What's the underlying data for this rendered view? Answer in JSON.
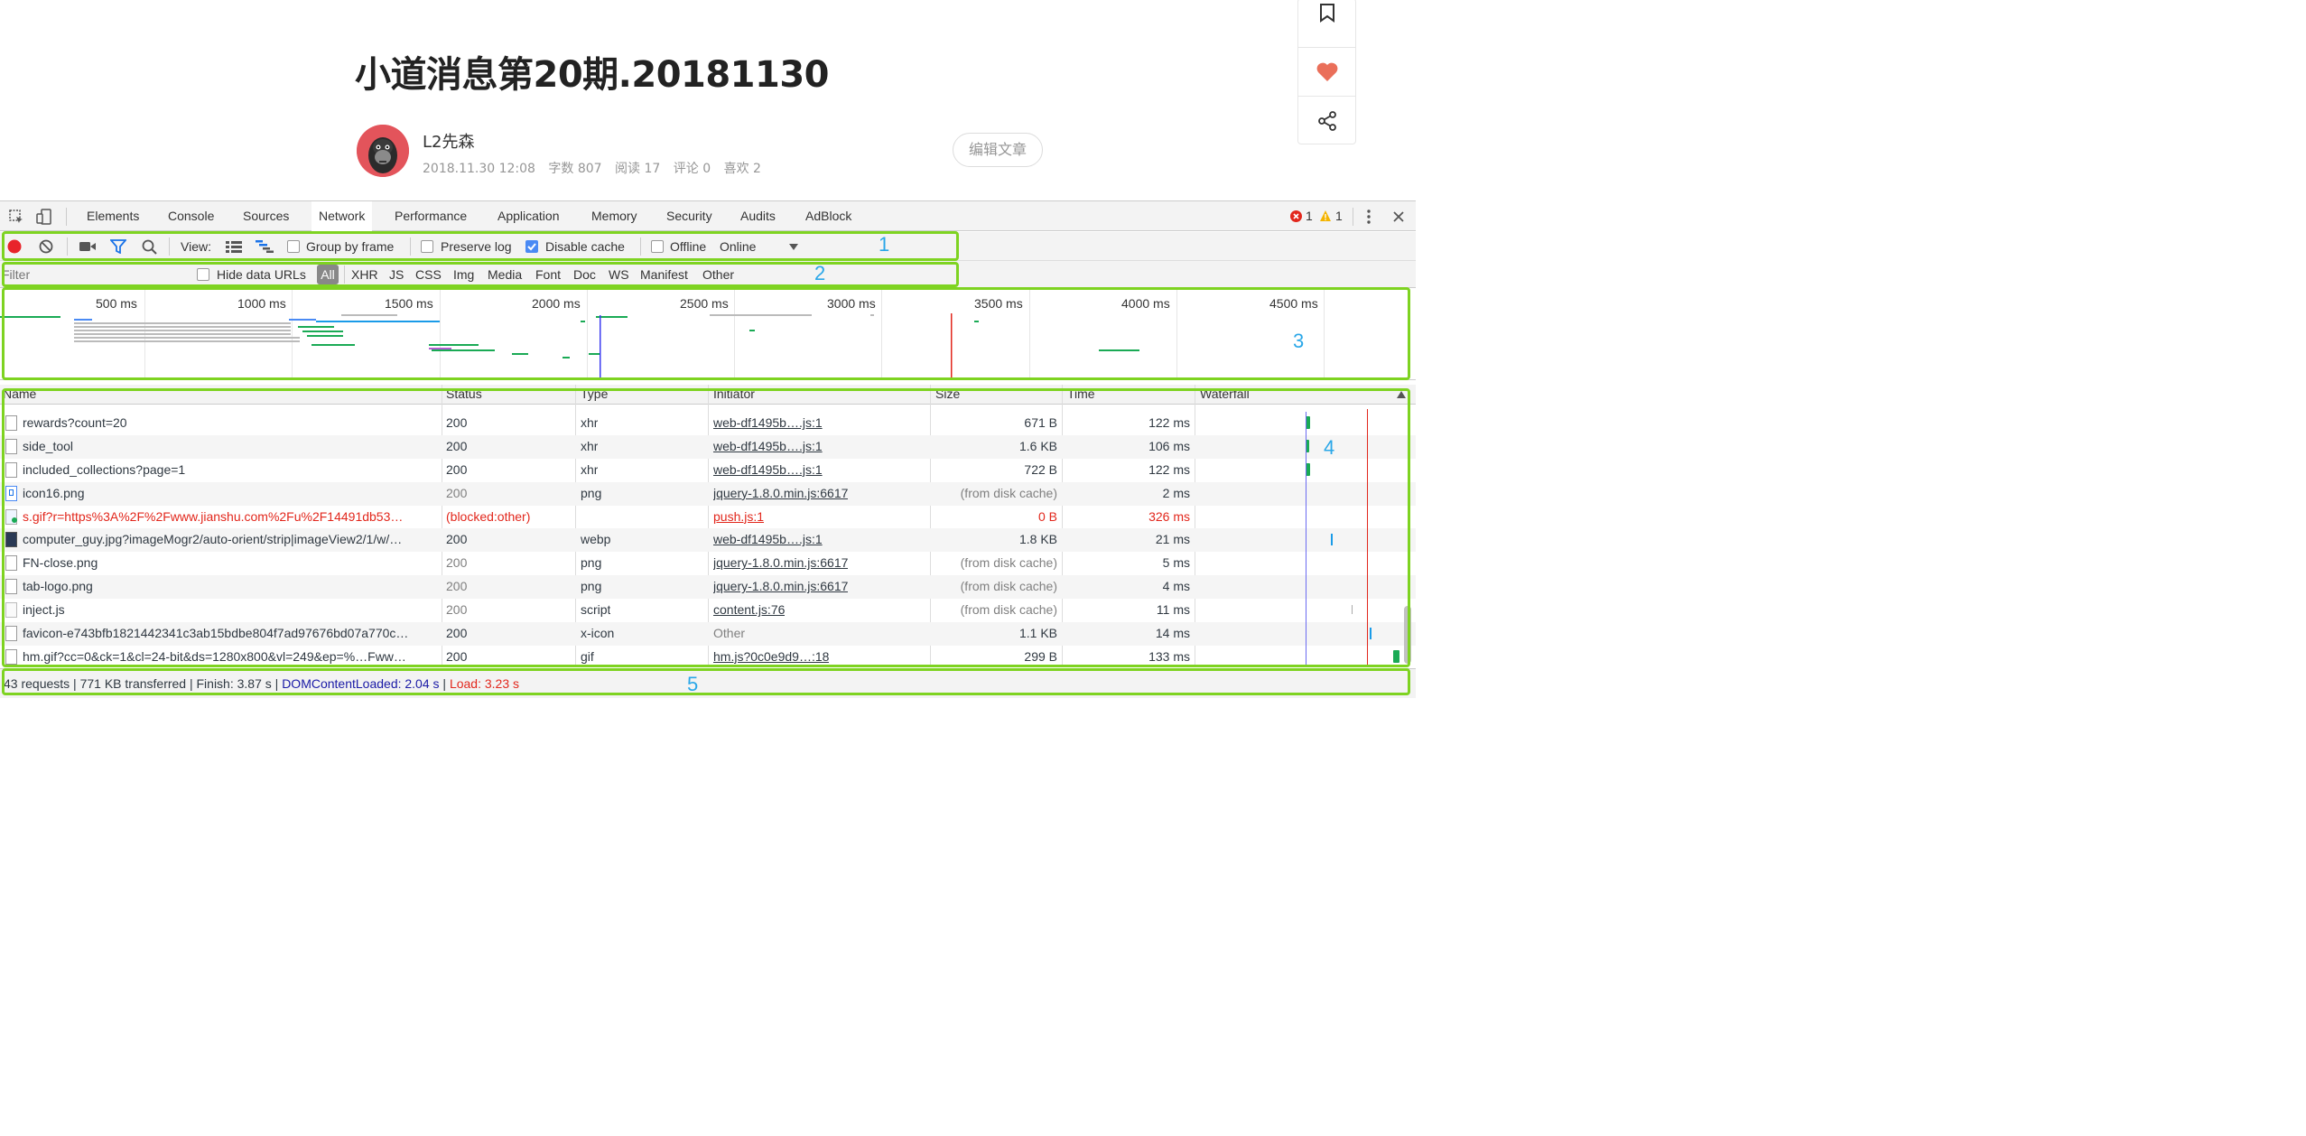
{
  "article": {
    "title": "小道消息第20期.20181130",
    "author": "L2先森",
    "date": "2018.11.30 12:08",
    "word_count": "字数 807",
    "reads": "阅读 17",
    "comments": "评论 0",
    "likes": "喜欢 2",
    "edit_button": "编辑文章"
  },
  "devtools": {
    "tabs": [
      "Elements",
      "Console",
      "Sources",
      "Network",
      "Performance",
      "Application",
      "Memory",
      "Security",
      "Audits",
      "AdBlock"
    ],
    "active_tab": "Network",
    "error_count": "1",
    "warning_count": "1",
    "toolbar": {
      "view_label": "View:",
      "group_by_frame": "Group by frame",
      "preserve_log": "Preserve log",
      "disable_cache": "Disable cache",
      "offline": "Offline",
      "throttle": "Online"
    },
    "filter": {
      "placeholder": "Filter",
      "hide_data_urls": "Hide data URLs",
      "types": [
        "All",
        "XHR",
        "JS",
        "CSS",
        "Img",
        "Media",
        "Font",
        "Doc",
        "WS",
        "Manifest",
        "Other"
      ]
    },
    "overview_ticks": [
      "500 ms",
      "1000 ms",
      "1500 ms",
      "2000 ms",
      "2500 ms",
      "3000 ms",
      "3500 ms",
      "4000 ms",
      "4500 ms"
    ],
    "columns": [
      "Name",
      "Status",
      "Type",
      "Initiator",
      "Size",
      "Time",
      "Waterfall"
    ],
    "requests": [
      {
        "name": "rewards?count=20",
        "status": "200",
        "type": "xhr",
        "initiator": "web-df1495b….js:1",
        "size": "671 B",
        "time": "122 ms"
      },
      {
        "name": "side_tool",
        "status": "200",
        "type": "xhr",
        "initiator": "web-df1495b….js:1",
        "size": "1.6 KB",
        "time": "106 ms"
      },
      {
        "name": "included_collections?page=1",
        "status": "200",
        "type": "xhr",
        "initiator": "web-df1495b….js:1",
        "size": "722 B",
        "time": "122 ms"
      },
      {
        "name": "icon16.png",
        "status": "200",
        "type": "png",
        "initiator": "jquery-1.8.0.min.js:6617",
        "size": "(from disk cache)",
        "time": "2 ms"
      },
      {
        "name": "s.gif?r=https%3A%2F%2Fwww.jianshu.com%2Fu%2F14491db53…",
        "status": "(blocked:other)",
        "type": "",
        "initiator": "push.js:1",
        "size": "0 B",
        "time": "326 ms"
      },
      {
        "name": "computer_guy.jpg?imageMogr2/auto-orient/strip|imageView2/1/w/…",
        "status": "200",
        "type": "webp",
        "initiator": "web-df1495b….js:1",
        "size": "1.8 KB",
        "time": "21 ms"
      },
      {
        "name": "FN-close.png",
        "status": "200",
        "type": "png",
        "initiator": "jquery-1.8.0.min.js:6617",
        "size": "(from disk cache)",
        "time": "5 ms"
      },
      {
        "name": "tab-logo.png",
        "status": "200",
        "type": "png",
        "initiator": "jquery-1.8.0.min.js:6617",
        "size": "(from disk cache)",
        "time": "4 ms"
      },
      {
        "name": "inject.js",
        "status": "200",
        "type": "script",
        "initiator": "content.js:76",
        "size": "(from disk cache)",
        "time": "11 ms"
      },
      {
        "name": "favicon-e743bfb1821442341c3ab15bdbe804f7ad97676bd07a770c…",
        "status": "200",
        "type": "x-icon",
        "initiator": "Other",
        "size": "1.1 KB",
        "time": "14 ms"
      },
      {
        "name": "hm.gif?cc=0&ck=1&cl=24-bit&ds=1280x800&vl=249&ep=%…Fww…",
        "status": "200",
        "type": "gif",
        "initiator": "hm.js?0c0e9d9…:18",
        "size": "299 B",
        "time": "133 ms"
      }
    ],
    "summary": {
      "main": "43 requests | 771 KB transferred | Finish: 3.87 s | ",
      "dom_content_loaded": "DOMContentLoaded: 2.04 s",
      "separator": " | ",
      "load": "Load: 3.23 s"
    }
  },
  "annotations": [
    "1",
    "2",
    "3",
    "4",
    "5"
  ],
  "colors": {
    "annotation_box": "#7ed321",
    "annotation_number": "#2aa7e8",
    "error": "#e2271c",
    "dom_loaded": "#1a1aa6",
    "record": "#e8232a"
  }
}
